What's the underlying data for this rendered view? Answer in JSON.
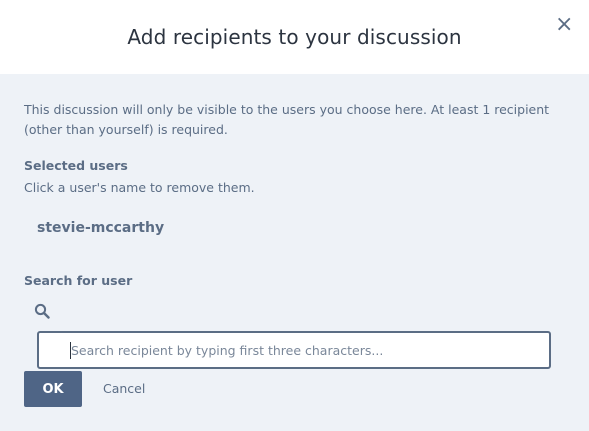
{
  "dialog": {
    "title": "Add recipients to your discussion",
    "close_icon": "close-icon",
    "close_glyph": "×"
  },
  "notice": "This discussion will only be visible to the users you choose here. At least 1 recipient (other than yourself) is required.",
  "selected": {
    "label": "Selected users",
    "hint": "Click a user's name to remove them.",
    "users": [
      "stevie-mccarthy"
    ]
  },
  "search": {
    "label": "Search for user",
    "icon": "search-icon",
    "value": "",
    "placeholder": "Search recipient by typing first three characters..."
  },
  "actions": {
    "ok_label": "OK",
    "cancel_label": "Cancel"
  },
  "colors": {
    "accent": "#4f6586",
    "text_muted": "#5b6d85",
    "background": "#eef2f7"
  }
}
